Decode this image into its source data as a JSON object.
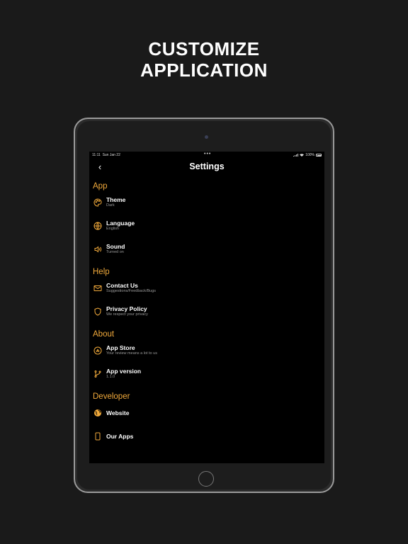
{
  "headline": {
    "line1": "CUSTOMIZE",
    "line2": "APPLICATION"
  },
  "status_bar": {
    "time": "11:11",
    "date": "Sun Jan 22",
    "dots": "•••",
    "battery": "100%"
  },
  "nav": {
    "back_icon": "chevron-left-icon",
    "back_glyph": "‹",
    "title": "Settings"
  },
  "colors": {
    "accent": "#f0a93b",
    "screen_bg": "#000000",
    "page_bg": "#1a1a1a"
  },
  "sections": {
    "app": {
      "title": "App",
      "items": [
        {
          "icon": "palette-icon",
          "title": "Theme",
          "subtitle": "Dark"
        },
        {
          "icon": "globe-icon",
          "title": "Language",
          "subtitle": "English"
        },
        {
          "icon": "speaker-icon",
          "title": "Sound",
          "subtitle": "Turned on"
        }
      ]
    },
    "help": {
      "title": "Help",
      "items": [
        {
          "icon": "mail-icon",
          "title": "Contact Us",
          "subtitle": "Suggestions/Feedback/Bugs"
        },
        {
          "icon": "shield-icon",
          "title": "Privacy Policy",
          "subtitle": "We respect your privacy"
        }
      ]
    },
    "about": {
      "title": "About",
      "items": [
        {
          "icon": "app-store-icon",
          "title": "App Store",
          "subtitle": "Your review means a lot to us"
        },
        {
          "icon": "git-branch-icon",
          "title": "App version",
          "subtitle": "1.1.0"
        }
      ]
    },
    "developer": {
      "title": "Developer",
      "items": [
        {
          "icon": "globe-filled-icon",
          "title": "Website"
        },
        {
          "icon": "phone-icon",
          "title": "Our Apps"
        }
      ]
    }
  }
}
